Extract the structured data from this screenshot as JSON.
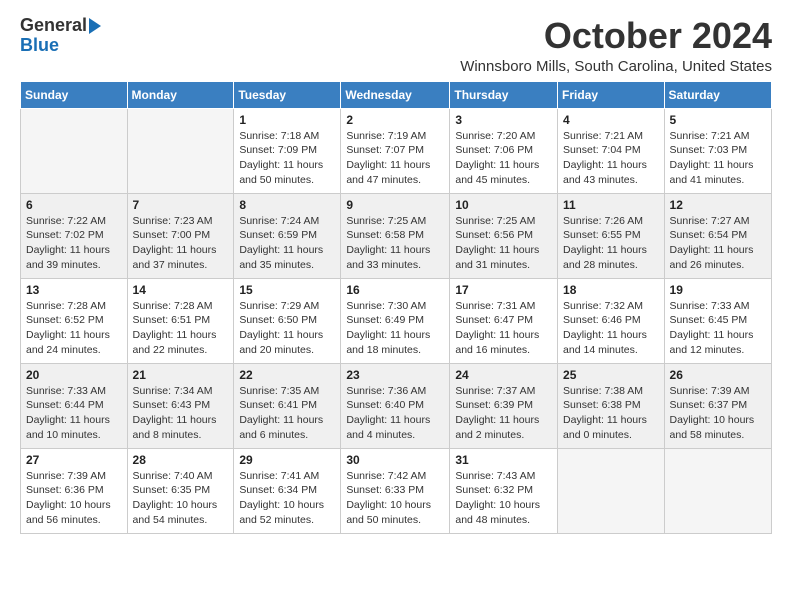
{
  "logo": {
    "general": "General",
    "blue": "Blue"
  },
  "title": "October 2024",
  "location": "Winnsboro Mills, South Carolina, United States",
  "days_of_week": [
    "Sunday",
    "Monday",
    "Tuesday",
    "Wednesday",
    "Thursday",
    "Friday",
    "Saturday"
  ],
  "weeks": [
    [
      {
        "num": "",
        "empty": true
      },
      {
        "num": "",
        "empty": true
      },
      {
        "num": "1",
        "sunrise": "Sunrise: 7:18 AM",
        "sunset": "Sunset: 7:09 PM",
        "daylight": "Daylight: 11 hours and 50 minutes."
      },
      {
        "num": "2",
        "sunrise": "Sunrise: 7:19 AM",
        "sunset": "Sunset: 7:07 PM",
        "daylight": "Daylight: 11 hours and 47 minutes."
      },
      {
        "num": "3",
        "sunrise": "Sunrise: 7:20 AM",
        "sunset": "Sunset: 7:06 PM",
        "daylight": "Daylight: 11 hours and 45 minutes."
      },
      {
        "num": "4",
        "sunrise": "Sunrise: 7:21 AM",
        "sunset": "Sunset: 7:04 PM",
        "daylight": "Daylight: 11 hours and 43 minutes."
      },
      {
        "num": "5",
        "sunrise": "Sunrise: 7:21 AM",
        "sunset": "Sunset: 7:03 PM",
        "daylight": "Daylight: 11 hours and 41 minutes."
      }
    ],
    [
      {
        "num": "6",
        "sunrise": "Sunrise: 7:22 AM",
        "sunset": "Sunset: 7:02 PM",
        "daylight": "Daylight: 11 hours and 39 minutes."
      },
      {
        "num": "7",
        "sunrise": "Sunrise: 7:23 AM",
        "sunset": "Sunset: 7:00 PM",
        "daylight": "Daylight: 11 hours and 37 minutes."
      },
      {
        "num": "8",
        "sunrise": "Sunrise: 7:24 AM",
        "sunset": "Sunset: 6:59 PM",
        "daylight": "Daylight: 11 hours and 35 minutes."
      },
      {
        "num": "9",
        "sunrise": "Sunrise: 7:25 AM",
        "sunset": "Sunset: 6:58 PM",
        "daylight": "Daylight: 11 hours and 33 minutes."
      },
      {
        "num": "10",
        "sunrise": "Sunrise: 7:25 AM",
        "sunset": "Sunset: 6:56 PM",
        "daylight": "Daylight: 11 hours and 31 minutes."
      },
      {
        "num": "11",
        "sunrise": "Sunrise: 7:26 AM",
        "sunset": "Sunset: 6:55 PM",
        "daylight": "Daylight: 11 hours and 28 minutes."
      },
      {
        "num": "12",
        "sunrise": "Sunrise: 7:27 AM",
        "sunset": "Sunset: 6:54 PM",
        "daylight": "Daylight: 11 hours and 26 minutes."
      }
    ],
    [
      {
        "num": "13",
        "sunrise": "Sunrise: 7:28 AM",
        "sunset": "Sunset: 6:52 PM",
        "daylight": "Daylight: 11 hours and 24 minutes."
      },
      {
        "num": "14",
        "sunrise": "Sunrise: 7:28 AM",
        "sunset": "Sunset: 6:51 PM",
        "daylight": "Daylight: 11 hours and 22 minutes."
      },
      {
        "num": "15",
        "sunrise": "Sunrise: 7:29 AM",
        "sunset": "Sunset: 6:50 PM",
        "daylight": "Daylight: 11 hours and 20 minutes."
      },
      {
        "num": "16",
        "sunrise": "Sunrise: 7:30 AM",
        "sunset": "Sunset: 6:49 PM",
        "daylight": "Daylight: 11 hours and 18 minutes."
      },
      {
        "num": "17",
        "sunrise": "Sunrise: 7:31 AM",
        "sunset": "Sunset: 6:47 PM",
        "daylight": "Daylight: 11 hours and 16 minutes."
      },
      {
        "num": "18",
        "sunrise": "Sunrise: 7:32 AM",
        "sunset": "Sunset: 6:46 PM",
        "daylight": "Daylight: 11 hours and 14 minutes."
      },
      {
        "num": "19",
        "sunrise": "Sunrise: 7:33 AM",
        "sunset": "Sunset: 6:45 PM",
        "daylight": "Daylight: 11 hours and 12 minutes."
      }
    ],
    [
      {
        "num": "20",
        "sunrise": "Sunrise: 7:33 AM",
        "sunset": "Sunset: 6:44 PM",
        "daylight": "Daylight: 11 hours and 10 minutes."
      },
      {
        "num": "21",
        "sunrise": "Sunrise: 7:34 AM",
        "sunset": "Sunset: 6:43 PM",
        "daylight": "Daylight: 11 hours and 8 minutes."
      },
      {
        "num": "22",
        "sunrise": "Sunrise: 7:35 AM",
        "sunset": "Sunset: 6:41 PM",
        "daylight": "Daylight: 11 hours and 6 minutes."
      },
      {
        "num": "23",
        "sunrise": "Sunrise: 7:36 AM",
        "sunset": "Sunset: 6:40 PM",
        "daylight": "Daylight: 11 hours and 4 minutes."
      },
      {
        "num": "24",
        "sunrise": "Sunrise: 7:37 AM",
        "sunset": "Sunset: 6:39 PM",
        "daylight": "Daylight: 11 hours and 2 minutes."
      },
      {
        "num": "25",
        "sunrise": "Sunrise: 7:38 AM",
        "sunset": "Sunset: 6:38 PM",
        "daylight": "Daylight: 11 hours and 0 minutes."
      },
      {
        "num": "26",
        "sunrise": "Sunrise: 7:39 AM",
        "sunset": "Sunset: 6:37 PM",
        "daylight": "Daylight: 10 hours and 58 minutes."
      }
    ],
    [
      {
        "num": "27",
        "sunrise": "Sunrise: 7:39 AM",
        "sunset": "Sunset: 6:36 PM",
        "daylight": "Daylight: 10 hours and 56 minutes."
      },
      {
        "num": "28",
        "sunrise": "Sunrise: 7:40 AM",
        "sunset": "Sunset: 6:35 PM",
        "daylight": "Daylight: 10 hours and 54 minutes."
      },
      {
        "num": "29",
        "sunrise": "Sunrise: 7:41 AM",
        "sunset": "Sunset: 6:34 PM",
        "daylight": "Daylight: 10 hours and 52 minutes."
      },
      {
        "num": "30",
        "sunrise": "Sunrise: 7:42 AM",
        "sunset": "Sunset: 6:33 PM",
        "daylight": "Daylight: 10 hours and 50 minutes."
      },
      {
        "num": "31",
        "sunrise": "Sunrise: 7:43 AM",
        "sunset": "Sunset: 6:32 PM",
        "daylight": "Daylight: 10 hours and 48 minutes."
      },
      {
        "num": "",
        "empty": true
      },
      {
        "num": "",
        "empty": true
      }
    ]
  ]
}
